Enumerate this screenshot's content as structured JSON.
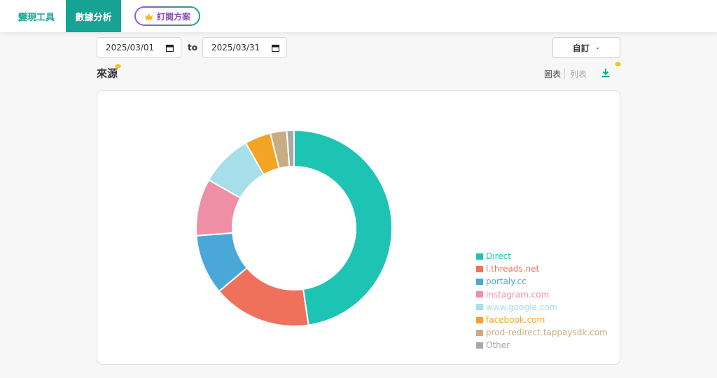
{
  "nav": {
    "monetize_tab": "變現工具",
    "analytics_tab": "數據分析",
    "plan_button": "訂閱方案"
  },
  "filters": {
    "start_date": "2025/03/01",
    "to_label": "to",
    "end_date": "2025/03/31",
    "range_select": "自訂"
  },
  "section": {
    "title": "來源",
    "view_chart": "圖表",
    "view_list": "列表"
  },
  "colors": {
    "accent": "#16a394",
    "pro_badge": "#f5c518"
  },
  "chart_data": {
    "type": "pie",
    "style": "donut",
    "legend_position": "right-bottom",
    "slices": [
      {
        "label": "Direct",
        "value": 47.6,
        "color": "#1dc4b3"
      },
      {
        "label": "l.threads.net",
        "value": 16.2,
        "color": "#ef705b"
      },
      {
        "label": "portaly.cc",
        "value": 9.9,
        "color": "#4aa8d8"
      },
      {
        "label": "instagram.com",
        "value": 9.4,
        "color": "#ef8fa6"
      },
      {
        "label": "www.google.com",
        "value": 8.6,
        "color": "#a6deea"
      },
      {
        "label": "facebook.com",
        "value": 4.3,
        "color": "#f4a424"
      },
      {
        "label": "prod-redirect.tappaysdk.com",
        "value": 2.7,
        "color": "#c9ad82"
      },
      {
        "label": "Other",
        "value": 1.2,
        "color": "#a8a8a8"
      }
    ]
  }
}
